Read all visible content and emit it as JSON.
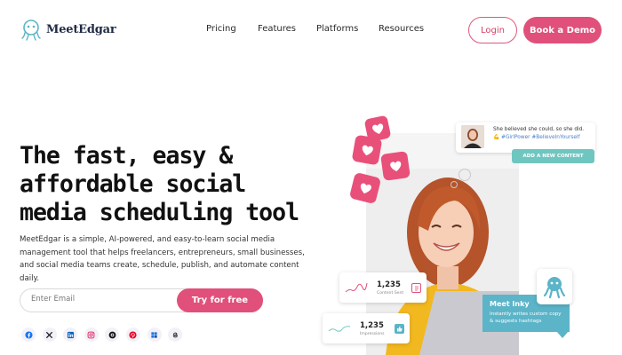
{
  "brand": {
    "name": "MeetEdgar",
    "accent": "#e0507a",
    "teal": "#6fc6c0"
  },
  "nav": {
    "links": [
      "Pricing",
      "Features",
      "Platforms",
      "Resources"
    ],
    "login_label": "Login",
    "demo_label": "Book a Demo"
  },
  "hero": {
    "headline": "The fast, easy & affordable social media scheduling tool",
    "subtext": "MeetEdgar is a simple, AI-powered, and easy-to-learn social media management tool that helps freelancers, entrepreneurs, small businesses, and social media teams create, schedule, publish, and automate content daily.",
    "email_placeholder": "Enter Email",
    "cta_label": "Try for free",
    "socials": [
      "facebook-icon",
      "x-icon",
      "linkedin-icon",
      "instagram-icon",
      "threads-icon",
      "pinterest-icon",
      "google-business-icon",
      "threads-alt-icon"
    ]
  },
  "visual": {
    "post_card": {
      "line1": "She believed she could, so she did.",
      "line2": "💪 #GirlPower #BelieveInYourself"
    },
    "add_content_label": "ADD A NEW CONTENT",
    "stat1": {
      "value": "1,235",
      "label": "Content Sent"
    },
    "stat2": {
      "value": "1,235",
      "label": "Impressions"
    },
    "inky": {
      "title": "Meet Inky",
      "description": "Instantly writes custom copy & suggests hashtags"
    }
  }
}
